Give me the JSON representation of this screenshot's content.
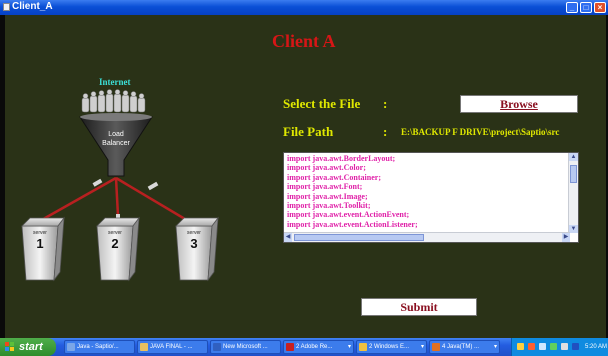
{
  "window": {
    "title": "Client_A"
  },
  "main": {
    "title": "Client A",
    "select_label": "Select the File",
    "colon": ":",
    "browse_label": "Browse",
    "path_label": "File Path",
    "path_value": "E:\\BACKUP F DRIVE\\project\\Saptio\\src",
    "code_lines": [
      "import java.awt.BorderLayout;",
      "import java.awt.Color;",
      "import java.awt.Container;",
      "import java.awt.Font;",
      "import java.awt.Image;",
      "import java.awt.Toolkit;",
      "import java.awt.event.ActionEvent;",
      "import java.awt.event.ActionListener;"
    ],
    "submit_label": "Submit"
  },
  "diagram": {
    "internet_label": "Internet",
    "balancer_line1": "Load",
    "balancer_line2": "Balancer",
    "servers": [
      {
        "caption": "server",
        "number": "1"
      },
      {
        "caption": "server",
        "number": "2"
      },
      {
        "caption": "server",
        "number": "3"
      }
    ]
  },
  "taskbar": {
    "start_label": "start",
    "tasks": [
      {
        "label": "Java - Saptio/...",
        "icon_color": "#7aa6e8"
      },
      {
        "label": "JAVA FINAL - ...",
        "icon_color": "#e8c060"
      },
      {
        "label": "New Microsoft ...",
        "icon_color": "#3060c0"
      },
      {
        "label": "2 Adobe Re...",
        "icon_color": "#c82020"
      },
      {
        "label": "2 Windows E...",
        "icon_color": "#f0c040"
      },
      {
        "label": "4 Java(TM) ...",
        "icon_color": "#e07020"
      }
    ],
    "clock": "5:20 AM"
  }
}
